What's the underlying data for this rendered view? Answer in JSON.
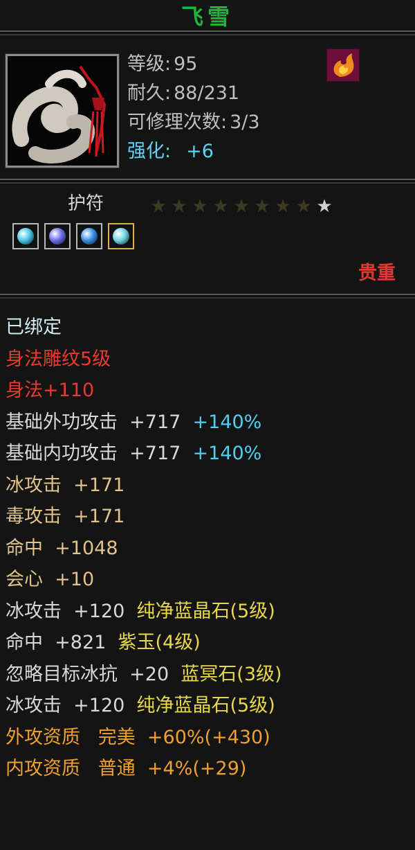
{
  "item": {
    "name": "飞雪",
    "name_color": "#22b43a",
    "type": "护符",
    "rarity": "贵重",
    "rarity_color": "#e03a2e",
    "icon": "jade-cloud-pendant-icon",
    "element_icon": "fire-element-icon"
  },
  "stats": [
    {
      "label": "等级",
      "sep": ":",
      "value": "95",
      "color": "#bfbfbf"
    },
    {
      "label": "耐久",
      "sep": ":",
      "value": "88/231",
      "color": "#bfbfbf"
    },
    {
      "label": "可修理次数",
      "sep": ":",
      "value": "3/3",
      "color": "#bfbfbf"
    },
    {
      "label": "强化",
      "sep": ":",
      "value": "+6",
      "color": "#5ad4f0"
    }
  ],
  "enhance_stars": {
    "total": 9,
    "lit": 1,
    "on_color": "#cfcfcf",
    "off_color": "#3d3b20"
  },
  "gem_slots": [
    {
      "icon": "cyan-gem-icon",
      "color": "#49c8e6",
      "frame": "silver"
    },
    {
      "icon": "violet-gem-icon",
      "color": "#6b6fe8",
      "frame": "silver"
    },
    {
      "icon": "blue-gem-icon",
      "color": "#3a8ee8",
      "frame": "silver"
    },
    {
      "icon": "cyan-gem-icon",
      "color": "#6fd6e0",
      "frame": "gold"
    }
  ],
  "attributes": [
    [
      {
        "text": "已绑定",
        "color": "#d4ecf4"
      }
    ],
    [
      {
        "text": "身法雕纹5级",
        "color": "#e83a2e"
      }
    ],
    [
      {
        "text": "身法+110",
        "color": "#e83a2e"
      }
    ],
    [
      {
        "text": "基础外功攻击  +717  ",
        "color": "#d8d8d8"
      },
      {
        "text": "+140%",
        "color": "#4fd0ec"
      }
    ],
    [
      {
        "text": "基础内功攻击  +717  ",
        "color": "#d8d8d8"
      },
      {
        "text": "+140%",
        "color": "#4fd0ec"
      }
    ],
    [
      {
        "text": "冰攻击  +171",
        "color": "#e0c28a"
      }
    ],
    [
      {
        "text": "毒攻击  +171",
        "color": "#e0c28a"
      }
    ],
    [
      {
        "text": "命中  +1048",
        "color": "#e0c28a"
      }
    ],
    [
      {
        "text": "会心  +10",
        "color": "#e0c28a"
      }
    ],
    [
      {
        "text": "冰攻击  +120  ",
        "color": "#d8d8d8"
      },
      {
        "text": "纯净蓝晶石(5级)",
        "color": "#e8d84a"
      }
    ],
    [
      {
        "text": "命中  +821  ",
        "color": "#d8d8d8"
      },
      {
        "text": "紫玉(4级)",
        "color": "#e8d84a"
      }
    ],
    [
      {
        "text": "忽略目标冰抗  +20  ",
        "color": "#d8d8d8"
      },
      {
        "text": "蓝冥石(3级)",
        "color": "#e8d84a"
      }
    ],
    [
      {
        "text": "冰攻击  +120  ",
        "color": "#d8d8d8"
      },
      {
        "text": "纯净蓝晶石(5级)",
        "color": "#e8d84a"
      }
    ],
    [
      {
        "text": "外攻资质   完美  +60%(+430)",
        "color": "#f0a030"
      }
    ],
    [
      {
        "text": "内攻资质   普通  +4%(+29)",
        "color": "#f0a030"
      }
    ]
  ]
}
